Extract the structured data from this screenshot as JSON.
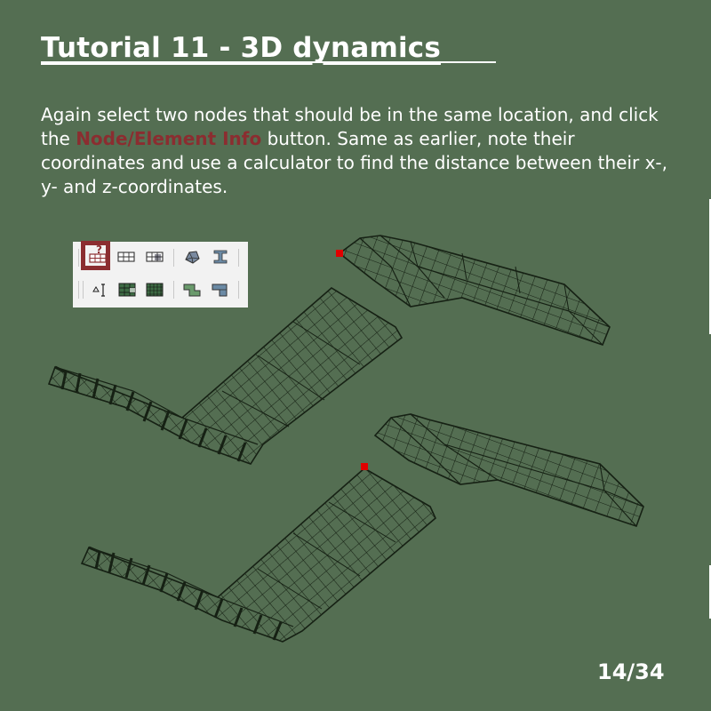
{
  "slide": {
    "title": "Tutorial 11 - 3D dynamics",
    "body_before": "Again select two nodes that should be in the same location, and click the ",
    "body_highlight": "Node/Element Info",
    "body_after": " button. Same as earlier, note their coordinates and use a calculator to find the distance between their x-, y- and z-coordinates.",
    "page_number": "14/34",
    "highlight_color": "#8b2d30",
    "background_color": "#546e52"
  },
  "toolbar": {
    "row1": [
      "node-element-info-icon",
      "mesh-grid-icon",
      "mesh-select-icon",
      "shape-icon",
      "ibeam-icon"
    ],
    "row2": [
      "dimension-icon",
      "mesh-fill-icon",
      "mesh-dense-icon",
      "angle-section-icon",
      "corner-section-icon"
    ],
    "highlighted": "node-element-info-icon",
    "highlight_badge": "?"
  },
  "scene": {
    "mesh_color": "#162114",
    "selected_node_color": "#e00000"
  }
}
